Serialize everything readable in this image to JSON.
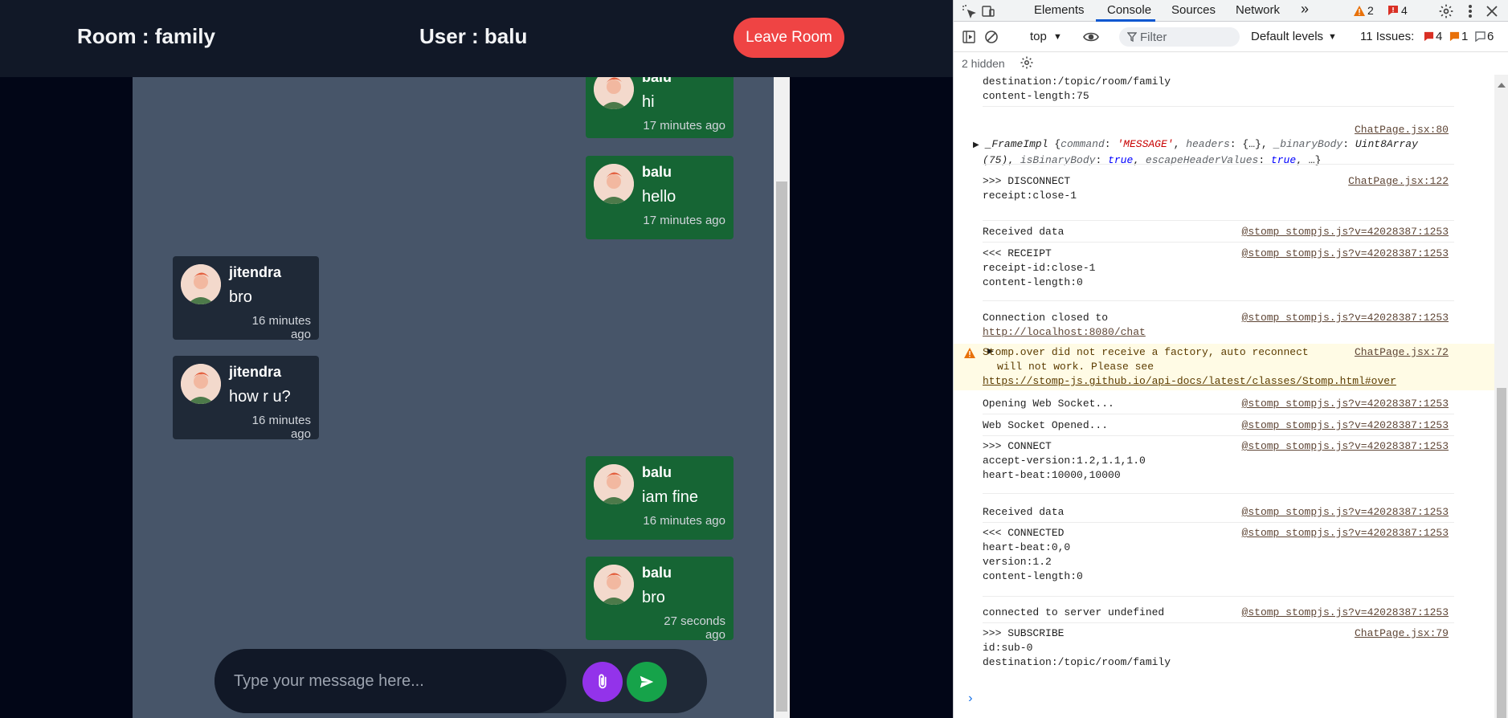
{
  "app": {
    "room_label": "Room : family",
    "user_label": "User : balu",
    "leave_button": "Leave Room",
    "input_placeholder": "Type your message here...",
    "messages": [
      {
        "sender": "balu",
        "text": "hi",
        "time": "17 minutes ago",
        "own": true
      },
      {
        "sender": "balu",
        "text": "hello",
        "time": "17 minutes ago",
        "own": true
      },
      {
        "sender": "jitendra",
        "text": "bro",
        "time": "16 minutes ago",
        "own": false
      },
      {
        "sender": "jitendra",
        "text": "how r u?",
        "time": "16 minutes ago",
        "own": false
      },
      {
        "sender": "balu",
        "text": "iam fine",
        "time": "16 minutes ago",
        "own": true
      },
      {
        "sender": "balu",
        "text": "bro",
        "time": "27 seconds ago",
        "own": true
      }
    ],
    "colors": {
      "own_bubble": "#166534",
      "other_bubble": "#1f2937",
      "leave": "#ef4444",
      "attach": "#9333ea",
      "send": "#16a34a"
    }
  },
  "devtools": {
    "tabs": [
      "Elements",
      "Console",
      "Sources",
      "Network"
    ],
    "active_tab": "Console",
    "more_tabs_icon": "»",
    "warnings_count": "2",
    "errors_count": "4",
    "context": "top",
    "filter_placeholder": "Filter",
    "levels": "Default levels",
    "issues_label": "11 Issues:",
    "issues_errors": "4",
    "issues_warnings": "1",
    "issues_info": "6",
    "hidden_label": "2 hidden",
    "logs": {
      "l0": {
        "lines": "destination:/topic/room/family\ncontent-length:75"
      },
      "l1": {
        "src": "ChatPage.jsx:80"
      },
      "l2": {
        "lines": ">>> DISCONNECT\nreceipt:close-1",
        "src": "ChatPage.jsx:122"
      },
      "l3": {
        "lines": "Received data",
        "src": "@stomp_stompjs.js?v=42028387:1253"
      },
      "l4": {
        "lines": "<<< RECEIPT\nreceipt-id:close-1\ncontent-length:0",
        "src": "@stomp_stompjs.js?v=42028387:1253"
      },
      "l5": {
        "lines": "Connection closed to",
        "link": "http://localhost:8080/chat",
        "src": "@stomp_stompjs.js?v=42028387:1253"
      },
      "l6": {
        "lines": "Stomp.over did not receive a factory, auto reconnect\nwill not work. Please see",
        "link": "https://stomp-js.github.io/api-docs/latest/classes/Stomp.html#over",
        "src": "ChatPage.jsx:72"
      },
      "l7": {
        "lines": "Opening Web Socket...",
        "src": "@stomp_stompjs.js?v=42028387:1253"
      },
      "l8": {
        "lines": "Web Socket Opened...",
        "src": "@stomp_stompjs.js?v=42028387:1253"
      },
      "l9": {
        "lines": ">>> CONNECT\naccept-version:1.2,1.1,1.0\nheart-beat:10000,10000",
        "src": "@stomp_stompjs.js?v=42028387:1253"
      },
      "l10": {
        "lines": "Received data",
        "src": "@stomp_stompjs.js?v=42028387:1253"
      },
      "l11": {
        "lines": "<<< CONNECTED\nheart-beat:0,0\nversion:1.2\ncontent-length:0",
        "src": "@stomp_stompjs.js?v=42028387:1253"
      },
      "l12": {
        "lines": "connected to server undefined",
        "src": "@stomp_stompjs.js?v=42028387:1253"
      },
      "l13": {
        "lines": ">>> SUBSCRIBE\nid:sub-0\ndestination:/topic/room/family",
        "src": "ChatPage.jsx:79"
      }
    },
    "frame": {
      "name": "_FrameImpl",
      "command_key": "command",
      "command_val": "'MESSAGE'",
      "headers_key": "headers",
      "headers_val": "{…}",
      "binary_key": "_binaryBody",
      "binary_val": "Uint8Array",
      "len": "(75)",
      "isbin_key": "isBinaryBody",
      "isbin_val": "true",
      "escape_key": "escapeHeaderValues",
      "escape_val": "true",
      "rest": "…}"
    }
  }
}
